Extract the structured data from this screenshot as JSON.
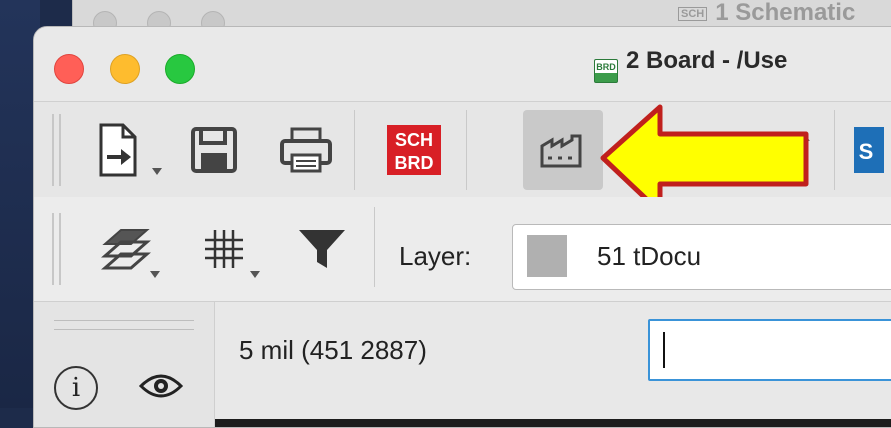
{
  "background_window": {
    "title": "1 Schematic",
    "badge": "SCH"
  },
  "window": {
    "title": "2 Board - /Use",
    "badge": "BRD"
  },
  "toolbar1": {
    "items": [
      {
        "name": "export-button",
        "icon": "document-export-icon"
      },
      {
        "name": "save-button",
        "icon": "floppy-disk-icon"
      },
      {
        "name": "print-button",
        "icon": "printer-icon"
      },
      {
        "name": "sch-brd-switch-button",
        "icon": "sch-brd-icon",
        "label_top": "SCH",
        "label_bottom": "BRD"
      },
      {
        "name": "manufacturing-button",
        "icon": "factory-icon"
      },
      {
        "name": "partial-button",
        "icon": "stack-icon"
      },
      {
        "name": "partial-button-2",
        "icon": "blue-app-icon",
        "label": "S"
      }
    ]
  },
  "toolbar2": {
    "layer_label": "Layer:",
    "layer_value": "51 tDocu",
    "layer_color": "#b0b0b0"
  },
  "status": {
    "coordinates": "5 mil (451 2887)",
    "command_placeholder": ""
  },
  "colors": {
    "accent_focus": "#3a93d8",
    "arrow_fill": "#ffff00",
    "arrow_stroke": "#c0201d",
    "sch_red": "#d81f26"
  }
}
